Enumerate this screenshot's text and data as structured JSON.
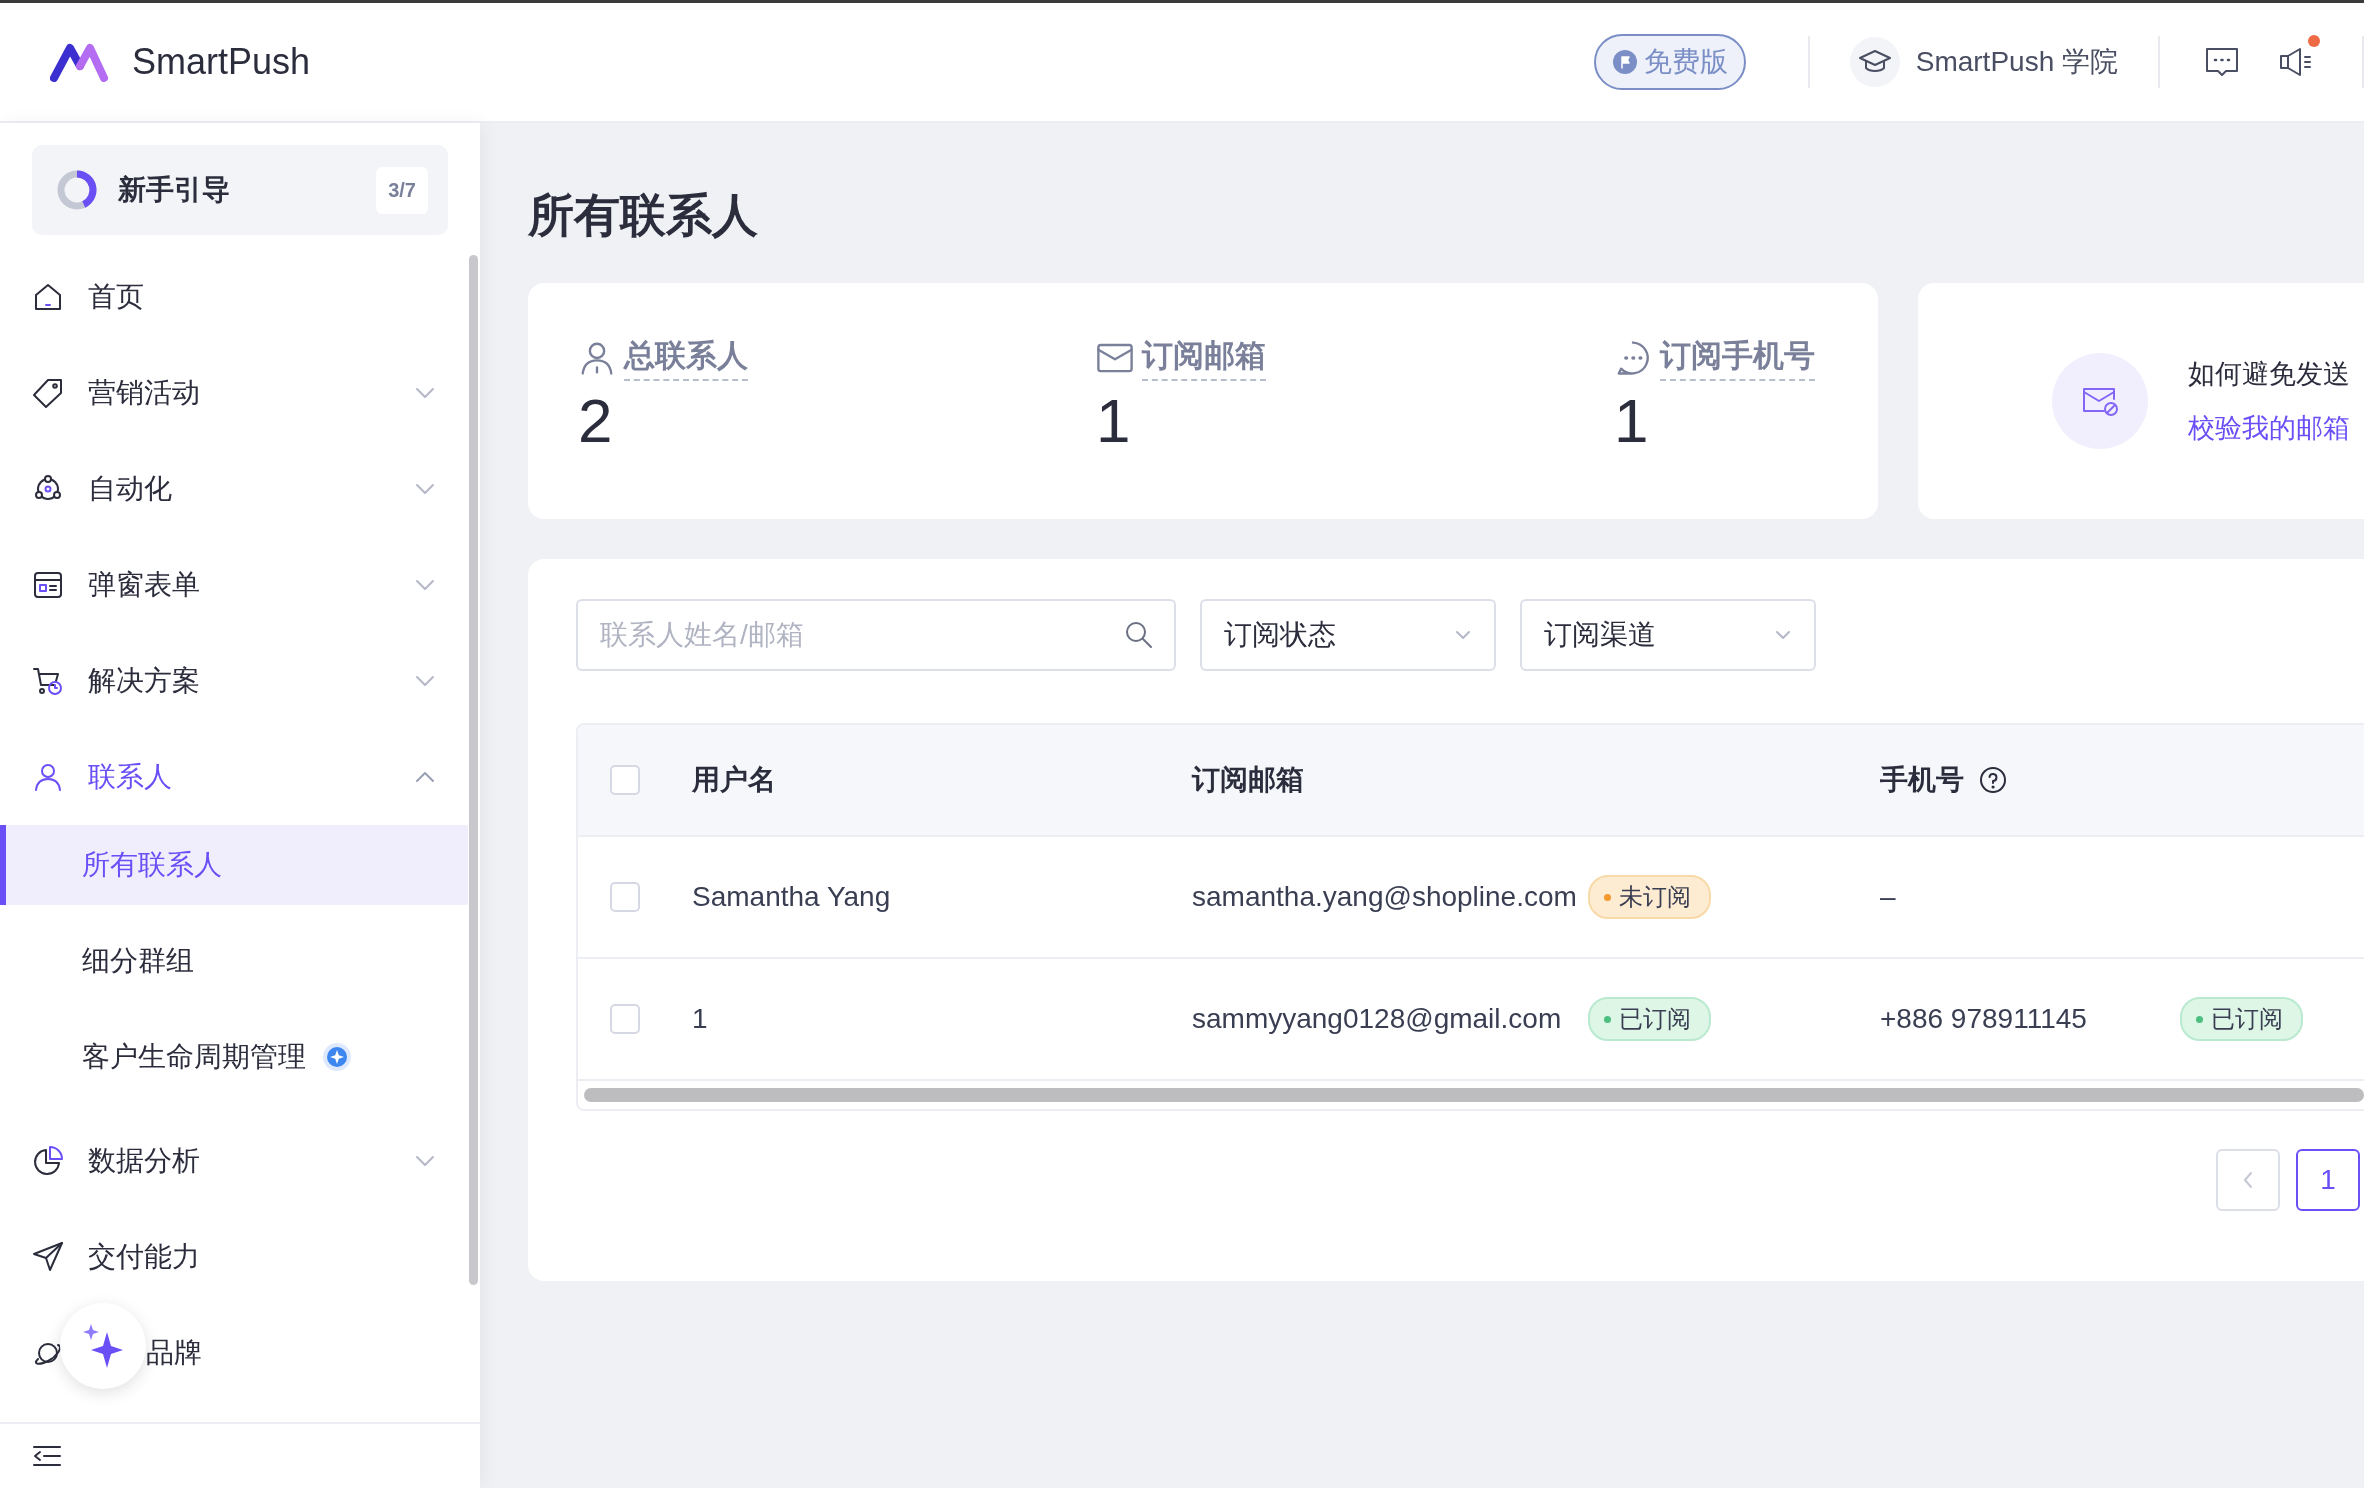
{
  "header": {
    "logo": "SmartPush",
    "plan_badge": "免费版",
    "academy_link": "SmartPush 学院",
    "announcement_unread": true
  },
  "sidebar": {
    "guide": {
      "label": "新手引导",
      "progress": "3/7",
      "level": 0.43
    },
    "items": [
      {
        "label": "首页",
        "expandable": false,
        "selected": false
      },
      {
        "label": "营销活动",
        "expandable": true,
        "expanded": false,
        "selected": false
      },
      {
        "label": "自动化",
        "expandable": true,
        "expanded": false,
        "selected": false
      },
      {
        "label": "弹窗表单",
        "expandable": true,
        "expanded": false,
        "selected": false
      },
      {
        "label": "解决方案",
        "expandable": true,
        "expanded": false,
        "selected": false
      },
      {
        "label": "联系人",
        "expandable": true,
        "expanded": true,
        "selected": true,
        "children": [
          {
            "label": "所有联系人",
            "selected": true,
            "new_badge": false
          },
          {
            "label": "细分群组",
            "selected": false,
            "new_badge": false
          },
          {
            "label": "客户生命周期管理",
            "selected": false,
            "new_badge": true
          }
        ]
      },
      {
        "label": "数据分析",
        "expandable": true,
        "expanded": false,
        "selected": false
      },
      {
        "label": "交付能力",
        "expandable": false,
        "selected": false
      },
      {
        "label": "品牌",
        "expandable": false,
        "selected": false
      }
    ]
  },
  "page_title": "所有联系人",
  "stats": [
    {
      "label": "总联系人",
      "value": "2"
    },
    {
      "label": "订阅邮箱",
      "value": "1"
    },
    {
      "label": "订阅手机号",
      "value": "1"
    }
  ],
  "tip": {
    "text": "如何避免发送",
    "link": "校验我的邮箱"
  },
  "filters": {
    "search": {
      "placeholder": "联系人姓名/邮箱"
    },
    "selects": [
      {
        "label": "订阅状态"
      },
      {
        "label": "订阅渠道"
      }
    ]
  },
  "table": {
    "header_checked": false,
    "columns": [
      {
        "label": "用户名",
        "help": false
      },
      {
        "label": "订阅邮箱",
        "help": false
      },
      {
        "label": "手机号",
        "help": true
      }
    ],
    "rows": [
      {
        "checked": false,
        "name": "Samantha Yang",
        "email": "samantha.yang@shopline.com",
        "email_status": {
          "label": "未订阅",
          "kind": "unsubscribed"
        },
        "phone": "–"
      },
      {
        "checked": false,
        "name": "1",
        "email": "sammyyang0128@gmail.com",
        "email_status": {
          "label": "已订阅",
          "kind": "subscribed"
        },
        "phone": "+886 978911145",
        "phone_status": {
          "label": "已订阅",
          "kind": "subscribed"
        }
      }
    ]
  },
  "pagination": {
    "prev_disabled": true,
    "pages": [
      {
        "label": "1",
        "selected": true
      }
    ]
  }
}
